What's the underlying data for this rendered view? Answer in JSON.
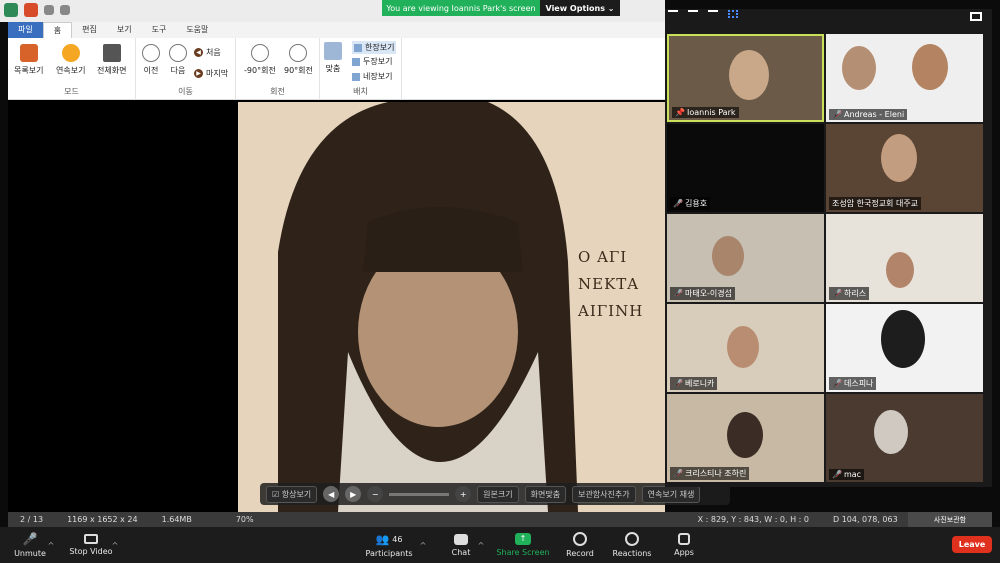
{
  "banner": {
    "message": "You are viewing Ioannis Park's screen",
    "view_options": "View Options"
  },
  "ribbon": {
    "tabs": [
      "파일",
      "홈",
      "편집",
      "보기",
      "도구",
      "도움말"
    ],
    "groups": {
      "mode": {
        "label": "모드",
        "buttons": [
          "목록보기",
          "연속보기",
          "전체화면"
        ]
      },
      "move": {
        "label": "이동",
        "buttons": [
          "이전",
          "다음"
        ],
        "small": [
          "처음",
          "마지막"
        ]
      },
      "rotate": {
        "label": "회전",
        "buttons": [
          "-90°회전",
          "90°회전"
        ]
      },
      "layout": {
        "label": "배치",
        "fit": "맞춤",
        "options": [
          "한장보기",
          "두장보기",
          "네장보기"
        ]
      }
    }
  },
  "image": {
    "greek_lines": [
      "Ο ΑΓΙ",
      "ΝΕΚΤΑ",
      "ΑΙΓΙΝΗ"
    ]
  },
  "viewer_toolbar": {
    "always": "항상보기",
    "buttons": [
      "원본크기",
      "화면맞춤",
      "보관함사진추가",
      "연속보기 재생"
    ]
  },
  "status": {
    "page": "2 / 13",
    "dims": "1169 x 1652 x 24",
    "size": "1.64MB",
    "zoom": "70%",
    "coords": "X : 829, Y : 843, W : 0, H : 0",
    "color": "D   104, 078, 063",
    "panel": "사진보관함"
  },
  "gallery": {
    "tiles": [
      {
        "name": "Ioannis Park",
        "muted": false,
        "pin": true
      },
      {
        "name": "Andreas - Eleni",
        "muted": true
      },
      {
        "name": "김용호",
        "muted": true
      },
      {
        "name": "조성암 한국정교회 대주교",
        "muted": false
      },
      {
        "name": "마태오-이경섭",
        "muted": true
      },
      {
        "name": "하리스",
        "muted": true
      },
      {
        "name": "베로니카",
        "muted": true
      },
      {
        "name": "데스피나",
        "muted": true
      },
      {
        "name": "크리스티나 조하린",
        "muted": true
      },
      {
        "name": "mac",
        "muted": true
      }
    ]
  },
  "zoom_bar": {
    "unmute": "Unmute",
    "stop_video": "Stop Video",
    "participants": "Participants",
    "participant_count": "46",
    "chat": "Chat",
    "share": "Share Screen",
    "record": "Record",
    "reactions": "Reactions",
    "apps": "Apps",
    "leave": "Leave"
  },
  "colors": {
    "share_green": "#20b15a",
    "leave_red": "#e0301e",
    "active_border": "#c8e05a"
  }
}
